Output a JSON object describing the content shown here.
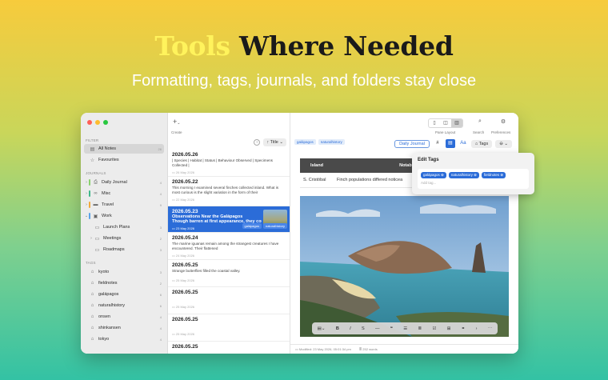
{
  "hero": {
    "title_highlight": "Tools",
    "title_rest": " Where Needed",
    "subtitle": "Formatting, tags, journals, and folders stay close"
  },
  "colors": {
    "accent": "#2b6cd8",
    "highlight": "#fff35c"
  },
  "sidebar": {
    "filter_label": "FILTER",
    "filters": [
      {
        "label": "All Notes",
        "count": "26",
        "icon": "tray-icon",
        "selected": true
      },
      {
        "label": "Favourites",
        "count": "",
        "icon": "star-icon",
        "selected": false
      }
    ],
    "journals_label": "JOURNALS",
    "journals": [
      {
        "label": "Daily Journal",
        "count": "4",
        "color": "#8ad16f",
        "icon": "paperclip-icon"
      },
      {
        "label": "Misc",
        "count": "4",
        "color": "#3fb88a",
        "icon": "infinity-icon"
      },
      {
        "label": "Travel",
        "count": "9",
        "color": "#f2a93b",
        "icon": "car-icon"
      },
      {
        "label": "Work",
        "count": "",
        "color": "#5aa2e8",
        "icon": "briefcase-icon"
      }
    ],
    "folders": [
      {
        "label": "Launch Plans",
        "count": "3"
      },
      {
        "label": "Meetings",
        "count": "2"
      },
      {
        "label": "Roadmaps",
        "count": "3"
      }
    ],
    "tags_label": "TAGS",
    "tags": [
      {
        "label": "kyoto",
        "count": "3"
      },
      {
        "label": "fieldnotes",
        "count": "2"
      },
      {
        "label": "galápagos",
        "count": "6"
      },
      {
        "label": "naturalhistory",
        "count": "6"
      },
      {
        "label": "onsen",
        "count": "4"
      },
      {
        "label": "shinkansen",
        "count": "4"
      },
      {
        "label": "tokyo",
        "count": "4"
      }
    ]
  },
  "notelist": {
    "create_label": "Create",
    "sort_label": "Title",
    "notes": [
      {
        "title": "2026.05.26",
        "preview": "| Species | Habitat | Status | Behaviour Observed | Specimens Collected |",
        "date": "26 May 2026"
      },
      {
        "title": "2026.05.22",
        "preview": "This morning I examined several finches collected inland. What is most curious is the slight variation in the form of their",
        "date": "22 May 2026"
      },
      {
        "title": "2026.05.23",
        "subtitle": "Observations Near the Galápagos",
        "preview": "Though barren at first appearance, they contain a",
        "date": "23 May 2026",
        "tags": [
          "galápagos",
          "naturalhistory"
        ]
      },
      {
        "title": "2026.05.24",
        "preview": "The marine iguanas remain among the strangest creatures I have encountered. Their flattened",
        "date": "24 May 2026"
      },
      {
        "title": "2026.05.25",
        "preview": "Strange butterflies filled the coastal valley.",
        "date": "25 May 2026"
      },
      {
        "title": "2026.05.25",
        "preview": "",
        "date": "25 May 2026"
      },
      {
        "title": "2026.05.25",
        "preview": "",
        "date": "25 May 2026"
      },
      {
        "title": "2026.05.25",
        "preview": "",
        "date": ""
      }
    ]
  },
  "editor": {
    "toolbar": {
      "pane_layout": "Pane Layout",
      "search": "Search",
      "preferences": "Preferences"
    },
    "tags": [
      "galápagos",
      "naturalhistory"
    ],
    "journal_button": "Daily Journal",
    "hash": "#",
    "aa": "Aa",
    "tags_button": "Tags",
    "table": {
      "headers": [
        "Island",
        "Notable Observation"
      ],
      "rows": [
        [
          "S. Cristóbal",
          "Finch populations differed noticea"
        ]
      ]
    },
    "status": {
      "modified": "Modified: 23 May 2026, 05:01:34 pm",
      "words": "252 words"
    }
  },
  "popover": {
    "title": "Edit Tags",
    "tags": [
      "galápagos",
      "naturalhistory",
      "fieldnotes"
    ],
    "placeholder": "Add tag..."
  }
}
